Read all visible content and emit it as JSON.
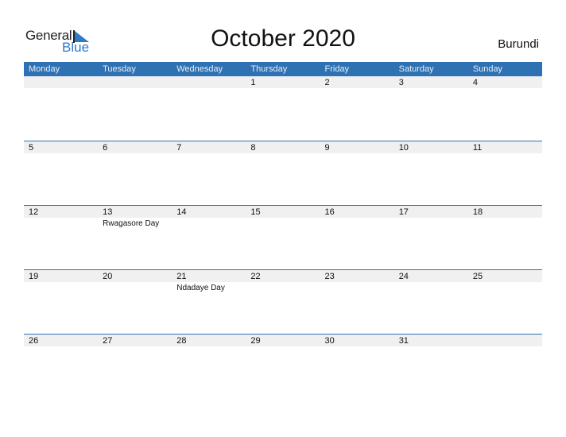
{
  "brand": {
    "general": "General",
    "blue": "Blue",
    "accent_color": "#2e72b4"
  },
  "title": "October 2020",
  "country": "Burundi",
  "weekdays": [
    "Monday",
    "Tuesday",
    "Wednesday",
    "Thursday",
    "Friday",
    "Saturday",
    "Sunday"
  ],
  "weeks": [
    {
      "days": [
        {
          "n": ""
        },
        {
          "n": ""
        },
        {
          "n": ""
        },
        {
          "n": "1"
        },
        {
          "n": "2"
        },
        {
          "n": "3"
        },
        {
          "n": "4"
        }
      ]
    },
    {
      "days": [
        {
          "n": "5"
        },
        {
          "n": "6"
        },
        {
          "n": "7"
        },
        {
          "n": "8"
        },
        {
          "n": "9"
        },
        {
          "n": "10"
        },
        {
          "n": "11"
        }
      ]
    },
    {
      "days": [
        {
          "n": "12"
        },
        {
          "n": "13",
          "ev": "Rwagasore Day"
        },
        {
          "n": "14"
        },
        {
          "n": "15"
        },
        {
          "n": "16"
        },
        {
          "n": "17"
        },
        {
          "n": "18"
        }
      ]
    },
    {
      "days": [
        {
          "n": "19"
        },
        {
          "n": "20"
        },
        {
          "n": "21",
          "ev": "Ndadaye Day"
        },
        {
          "n": "22"
        },
        {
          "n": "23"
        },
        {
          "n": "24"
        },
        {
          "n": "25"
        }
      ]
    },
    {
      "days": [
        {
          "n": "26"
        },
        {
          "n": "27"
        },
        {
          "n": "28"
        },
        {
          "n": "29"
        },
        {
          "n": "30"
        },
        {
          "n": "31"
        },
        {
          "n": ""
        }
      ]
    }
  ]
}
